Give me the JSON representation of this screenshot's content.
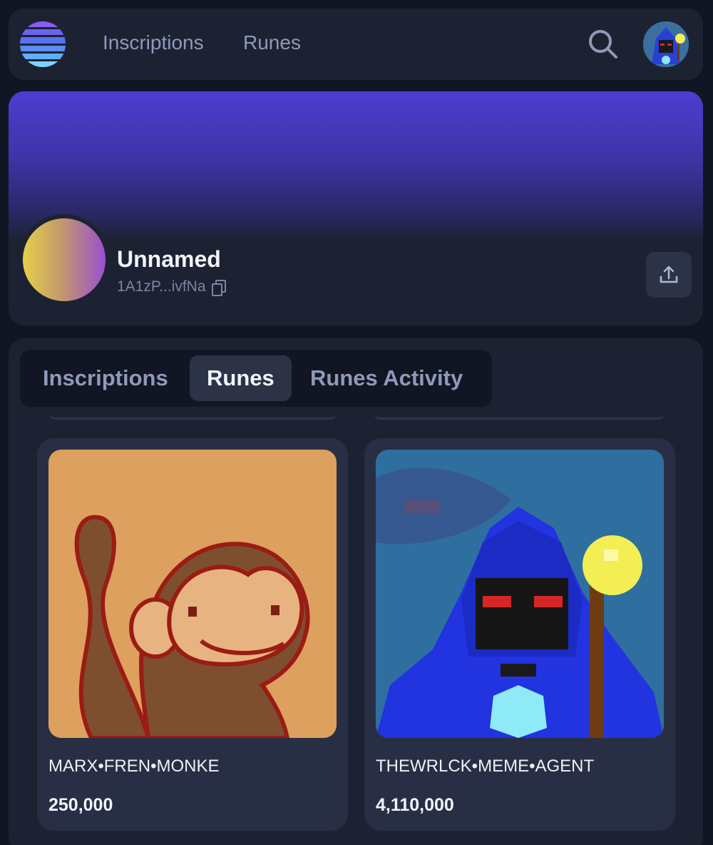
{
  "nav": {
    "links": [
      "Inscriptions",
      "Runes"
    ],
    "logo_colors": [
      "#8a5cf0",
      "#6a63ee",
      "#5a72f0",
      "#5a8cf2",
      "#5fb0f4",
      "#7ad6f7"
    ],
    "search_icon": "search-icon",
    "avatar_icon": "wizard-avatar"
  },
  "profile": {
    "name": "Unnamed",
    "address": "1A1zP...ivfNa",
    "copy_icon": "copy-icon",
    "share_icon": "share-upload-icon"
  },
  "tabs": [
    {
      "label": "Inscriptions",
      "active": false
    },
    {
      "label": "Runes",
      "active": true
    },
    {
      "label": "Runes Activity",
      "active": false
    }
  ],
  "runes": [
    {
      "name": "MARX•FREN•MONKE",
      "amount": "250,000",
      "image": "pixel-monkey"
    },
    {
      "name": "THEWRLCK•MEME•AGENT",
      "amount": "4,110,000",
      "image": "pixel-hooded-wizard"
    }
  ],
  "colors": {
    "background": "#121624",
    "surface": "#1d2233",
    "card": "#282f44",
    "banner_top": "#4d3ed2",
    "muted_text": "#8e9ab8"
  }
}
